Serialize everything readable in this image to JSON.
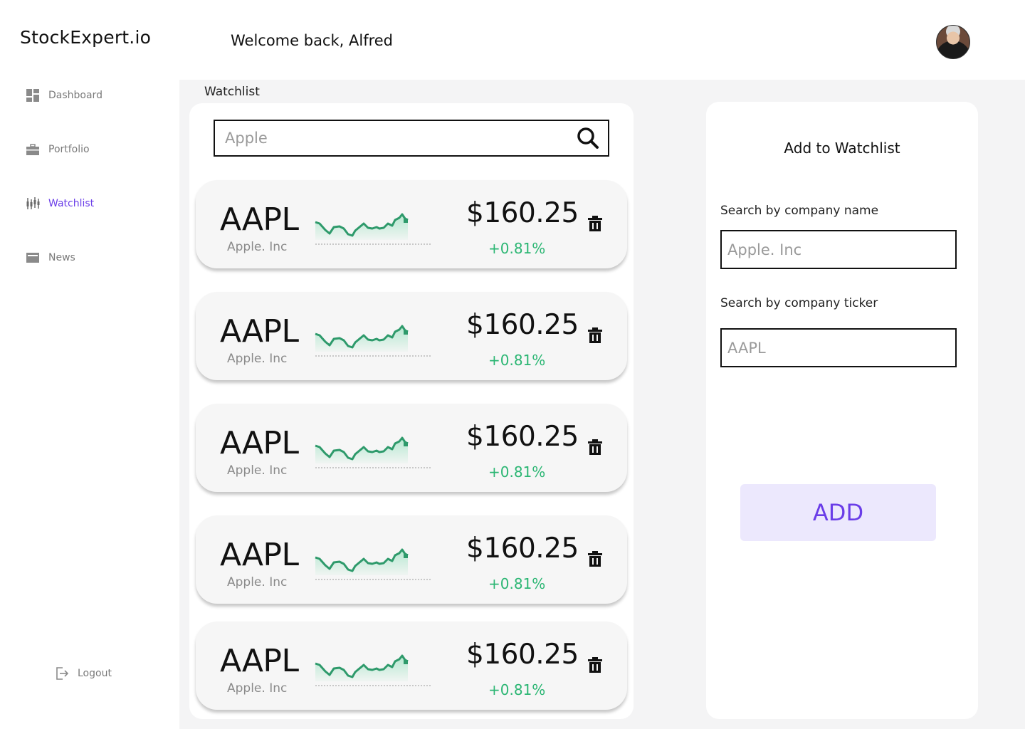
{
  "app": {
    "logo": "StockExpert.io",
    "welcome": "Welcome back, Alfred"
  },
  "sidebar": {
    "items": [
      {
        "label": "Dashboard",
        "icon": "dashboard-icon",
        "active": false
      },
      {
        "label": "Portfolio",
        "icon": "briefcase-icon",
        "active": false
      },
      {
        "label": "Watchlist",
        "icon": "candlestick-icon",
        "active": true
      },
      {
        "label": "News",
        "icon": "newspaper-icon",
        "active": false
      }
    ],
    "logout": "Logout"
  },
  "main": {
    "section_title": "Watchlist",
    "search": {
      "placeholder": "Apple",
      "value": ""
    },
    "stocks": [
      {
        "ticker": "AAPL",
        "company": "Apple. Inc",
        "price": "$160.25",
        "change": "+0.81%"
      },
      {
        "ticker": "AAPL",
        "company": "Apple. Inc",
        "price": "$160.25",
        "change": "+0.81%"
      },
      {
        "ticker": "AAPL",
        "company": "Apple. Inc",
        "price": "$160.25",
        "change": "+0.81%"
      },
      {
        "ticker": "AAPL",
        "company": "Apple. Inc",
        "price": "$160.25",
        "change": "+0.81%"
      },
      {
        "ticker": "AAPL",
        "company": "Apple. Inc",
        "price": "$160.25",
        "change": "+0.81%"
      }
    ]
  },
  "add_panel": {
    "title": "Add to Watchlist",
    "name_label": "Search by company name",
    "name_placeholder": "Apple. Inc",
    "ticker_label": "Search by company ticker",
    "ticker_placeholder": "AAPL",
    "button_label": "ADD"
  },
  "colors": {
    "accent": "#6a3de8",
    "positive": "#2bb673",
    "accent_bg": "#ece8fd",
    "panel_bg": "#f4f4f5"
  }
}
